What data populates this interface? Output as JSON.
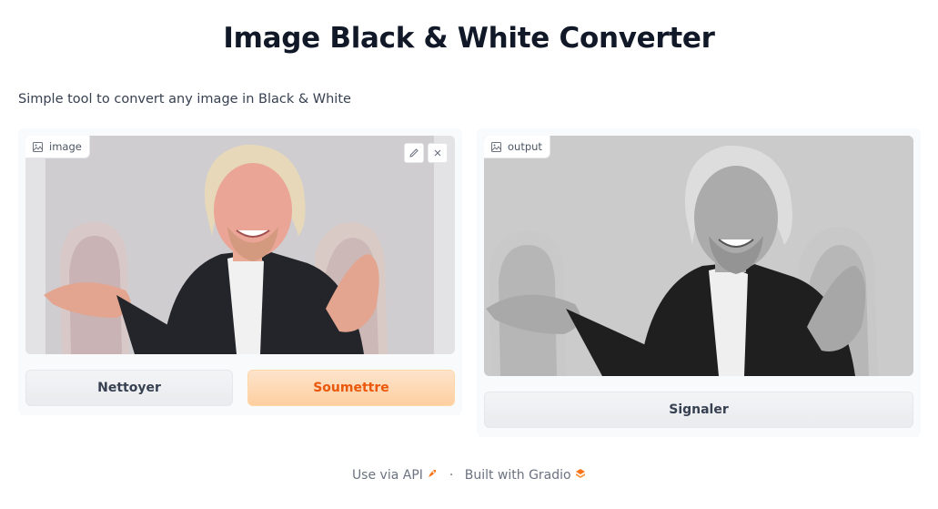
{
  "page": {
    "title": "Image Black & White Converter",
    "description": "Simple tool to convert any image in Black & White"
  },
  "input": {
    "label": "image",
    "image_alt": "Man with long blond hair smiling in dark blazer, color photo"
  },
  "output": {
    "label": "output",
    "image_alt": "Same photo converted to black and white"
  },
  "buttons": {
    "clear": "Nettoyer",
    "submit": "Soumettre",
    "flag": "Signaler"
  },
  "footer": {
    "api": "Use via API",
    "separator": "·",
    "built": "Built with Gradio"
  },
  "colors": {
    "accent": "#ea580c",
    "primary_bg": "#fdcfa0"
  }
}
